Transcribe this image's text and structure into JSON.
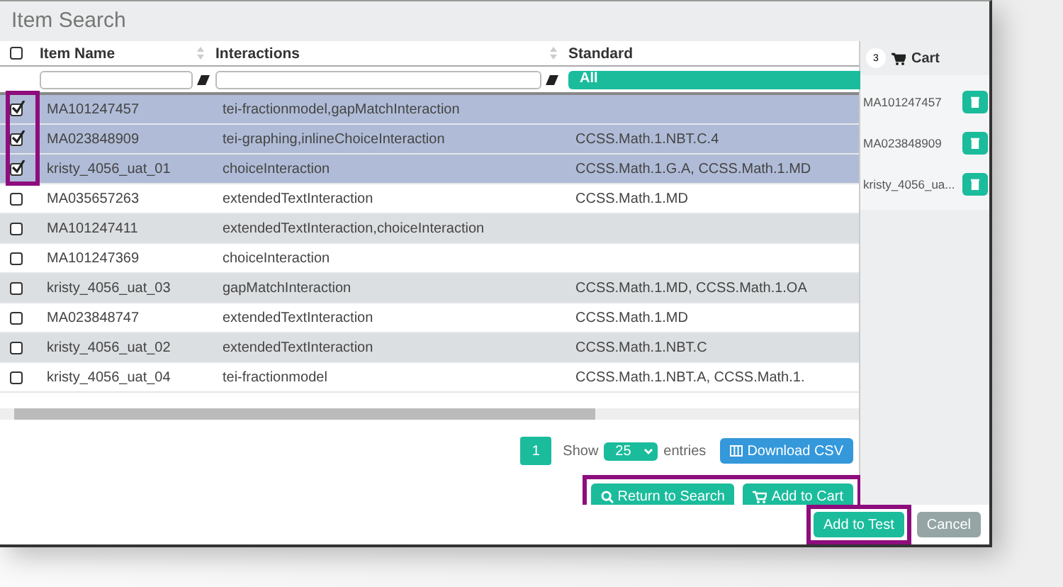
{
  "window": {
    "title": "Item Search"
  },
  "table": {
    "select_all_checked": false,
    "columns": [
      "Item Name",
      "Interactions",
      "Standard"
    ],
    "filters": [
      {
        "kind": "text"
      },
      {
        "kind": "text"
      },
      {
        "kind": "select",
        "value": "All"
      }
    ],
    "rows": [
      {
        "checked": true,
        "cells": [
          "MA101247457",
          "tei-fractionmodel,gapMatchInteraction",
          ""
        ]
      },
      {
        "checked": true,
        "cells": [
          "MA023848909",
          "tei-graphing,inlineChoiceInteraction",
          "CCSS.Math.1.NBT.C.4"
        ]
      },
      {
        "checked": true,
        "cells": [
          "kristy_4056_uat_01",
          "choiceInteraction",
          "CCSS.Math.1.G.A, CCSS.Math.1.MD"
        ]
      },
      {
        "checked": false,
        "cells": [
          "MA035657263",
          "extendedTextInteraction",
          "CCSS.Math.1.MD"
        ]
      },
      {
        "checked": false,
        "cells": [
          "MA101247411",
          "extendedTextInteraction,choiceInteraction",
          ""
        ]
      },
      {
        "checked": false,
        "cells": [
          "MA101247369",
          "choiceInteraction",
          ""
        ]
      },
      {
        "checked": false,
        "cells": [
          "kristy_4056_uat_03",
          "gapMatchInteraction",
          "CCSS.Math.1.MD, CCSS.Math.1.OA"
        ]
      },
      {
        "checked": false,
        "cells": [
          "MA023848747",
          "extendedTextInteraction",
          "CCSS.Math.1.MD"
        ]
      },
      {
        "checked": false,
        "cells": [
          "kristy_4056_uat_02",
          "extendedTextInteraction",
          "CCSS.Math.1.NBT.C"
        ]
      },
      {
        "checked": false,
        "cells": [
          "kristy_4056_uat_04",
          "tei-fractionmodel",
          "CCSS.Math.1.NBT.A, CCSS.Math.1."
        ]
      }
    ]
  },
  "pagination": {
    "page": "1",
    "show_label": "Show",
    "page_size": "25",
    "entries_label": "entries",
    "download_button": "Download CSV"
  },
  "actions": [
    "Return to Search",
    "Add to Cart"
  ],
  "cart": {
    "count": "3",
    "title": "Cart",
    "items": [
      "MA101247457",
      "MA023848909",
      "kristy_4056_ua..."
    ]
  },
  "dialog_buttons": [
    {
      "label": "Add to Test",
      "kind": "primary"
    },
    {
      "label": "Cancel",
      "kind": "secondary"
    }
  ]
}
